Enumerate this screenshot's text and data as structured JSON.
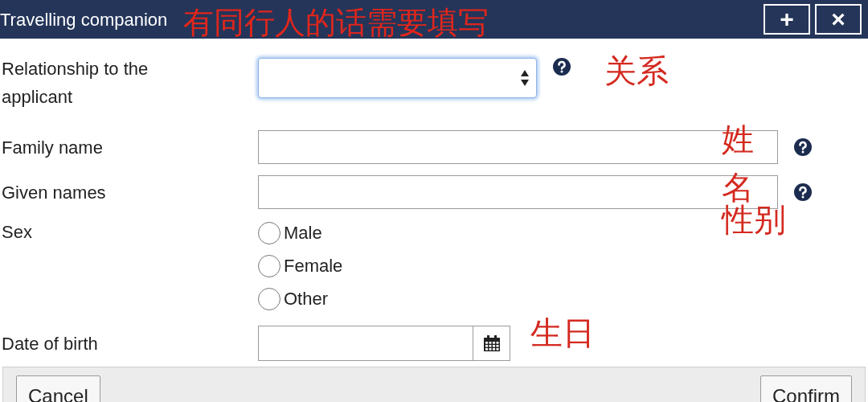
{
  "window": {
    "title": "Travelling companion",
    "annotation": "有同行人的话需要填写",
    "buttons": [
      {
        "label": "+"
      },
      {
        "label": "×"
      }
    ]
  },
  "fields": [
    {
      "kind": "select",
      "label": "Relationship to the applicant",
      "help": true,
      "annotation": "关系",
      "focused": true
    },
    {
      "kind": "text",
      "label": "Family name",
      "help": true,
      "annotation": "姓"
    },
    {
      "kind": "text",
      "label": "Given names",
      "help": true,
      "annotation": "名"
    },
    {
      "kind": "radio",
      "label": "Sex",
      "annotation": "性别",
      "options": [
        {
          "label": "Male",
          "selected": false
        },
        {
          "label": "Female",
          "selected": false
        },
        {
          "label": "Other",
          "selected": false
        }
      ]
    },
    {
      "kind": "date",
      "label": "Date of birth",
      "annotation": "生日"
    }
  ],
  "footer": {
    "buttons": [
      {
        "label": "Cancel"
      },
      {
        "label": "Confirm"
      }
    ]
  }
}
